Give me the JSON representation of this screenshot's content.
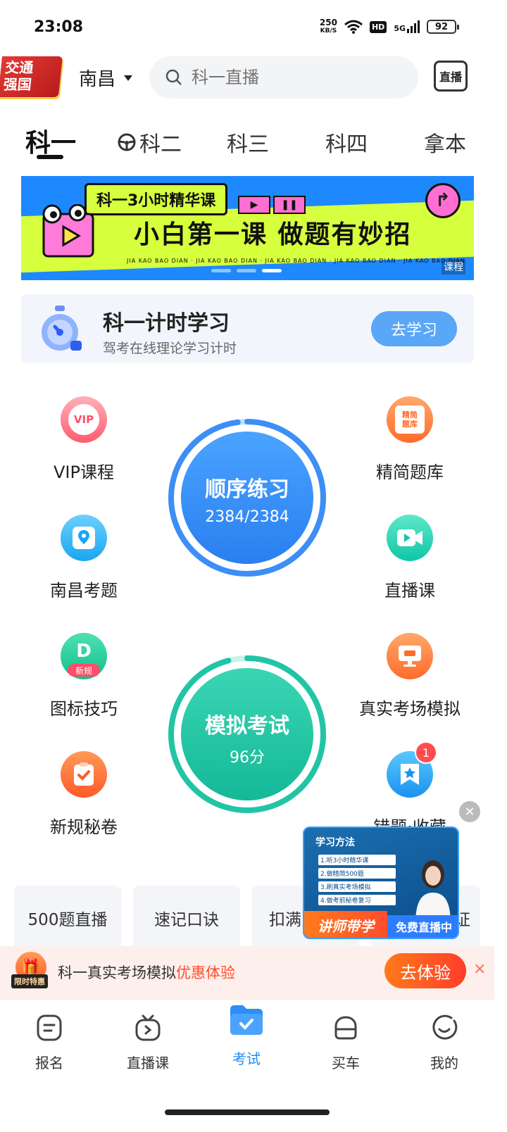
{
  "status_bar": {
    "time": "23:08",
    "net_speed_value": "250",
    "net_speed_unit": "KB/S",
    "hd": "HD",
    "signal": "5G",
    "battery": "92"
  },
  "header": {
    "logo_line1": "交通",
    "logo_line2": "强国",
    "city": "南昌",
    "search_placeholder": "科一直播",
    "live_label": "直播"
  },
  "tabs": [
    {
      "label": "科一"
    },
    {
      "label": "科二"
    },
    {
      "label": "科三"
    },
    {
      "label": "科四"
    },
    {
      "label": "拿本"
    }
  ],
  "banner": {
    "pill": "科一3小时精华课",
    "headline": "小白第一课 做题有妙招",
    "footer": "JIA KAO BAO DIAN · JIA KAO BAO DIAN · JIA KAO BAO DIAN · JIA KAO BAO DIAN · JIA KAO BAO DIAN",
    "tag": "课程"
  },
  "timer_card": {
    "title": "科一计时学习",
    "subtitle": "驾考在线理论学习计时",
    "button": "去学习"
  },
  "grid": {
    "vip": "VIP课程",
    "bank": "精简题库",
    "local": "南昌考题",
    "live": "直播课",
    "signs": "图标技巧",
    "signs_badge": "新规",
    "realexam": "真实考场模拟",
    "secret": "新规秘卷",
    "mistakes": "错题·收藏",
    "mistakes_badge": "1",
    "vip_icon_text": "VIP",
    "bank_icon_text1": "精简",
    "bank_icon_text2": "题库"
  },
  "practice": {
    "title": "顺序练习",
    "progress": "2384/2384",
    "done": 2384,
    "total": 2384
  },
  "exam": {
    "title": "模拟考试",
    "score": "96分",
    "score_value": 96
  },
  "quick": [
    "500题直播",
    "速记口诀",
    "扣满",
    "证"
  ],
  "floating_video": {
    "title": "学习方法",
    "steps": [
      "1.听3小时精华课",
      "2.做精简500题",
      "3.刷真实考场模拟",
      "4.做考前秘卷复习"
    ],
    "tag1": "讲师带学",
    "tag2": "免费直播中"
  },
  "promo": {
    "tag": "限时特惠",
    "text": "科一真实考场模拟",
    "highlight": "优惠体验",
    "button": "去体验",
    "close": "×"
  },
  "bottom_nav": [
    {
      "label": "报名"
    },
    {
      "label": "直播课"
    },
    {
      "label": "考试"
    },
    {
      "label": "买车"
    },
    {
      "label": "我的"
    }
  ],
  "colors": {
    "accent": "#1f8cf5",
    "practice": "#3d8ef5",
    "exam": "#22c4a6",
    "promo": "#ff4d2d"
  }
}
